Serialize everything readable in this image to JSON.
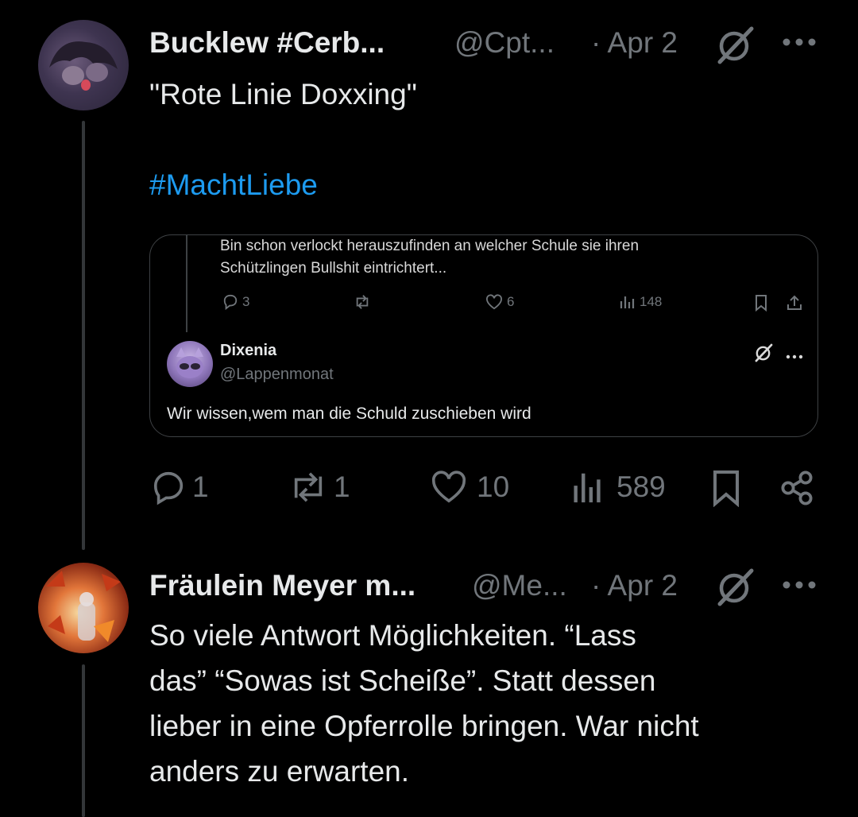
{
  "tweet1": {
    "display_name": "Bucklew #Cerb...",
    "handle": "@Cpt...",
    "date": "· Apr 2",
    "text_line1": "\"Rote Linie Doxxing\"",
    "hashtag": "#MachtLiebe",
    "actions": {
      "replies": "1",
      "reposts": "1",
      "likes": "10",
      "views": "589"
    }
  },
  "quote": {
    "parent_text_line1": "Bin schon verlockt herauszufinden an welcher Schule sie ihren",
    "parent_text_line2": "Schützlingen Bullshit eintrichtert...",
    "parent_actions": {
      "replies": "3",
      "likes": "6",
      "views": "148"
    },
    "display_name": "Dixenia",
    "handle": "@Lappenmonat",
    "text": "Wir wissen,wem man die Schuld zuschieben wird"
  },
  "tweet2": {
    "display_name": "Fräulein Meyer m...",
    "handle": "@Me...",
    "date": "· Apr 2",
    "text_lines": [
      "So viele Antwort Möglichkeiten. “Lass",
      "das” “Sowas ist Scheiße”. Statt dessen",
      "lieber in eine Opferrolle bringen. War nicht",
      "anders zu erwarten."
    ]
  },
  "icons": [
    "badge-icon",
    "more-icon",
    "reply-icon",
    "repost-icon",
    "like-icon",
    "views-icon",
    "bookmark-icon",
    "share-icon"
  ]
}
